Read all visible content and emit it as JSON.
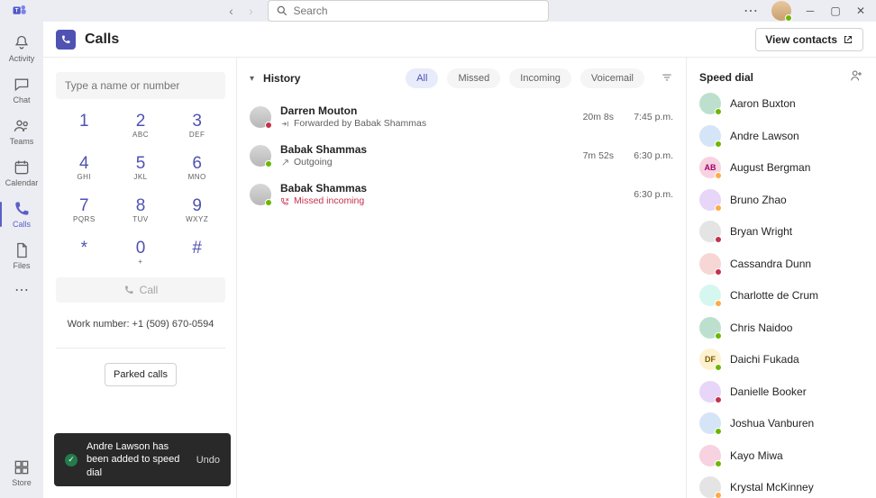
{
  "titlebar": {
    "search_placeholder": "Search"
  },
  "rail": {
    "activity": "Activity",
    "chat": "Chat",
    "teams": "Teams",
    "calendar": "Calendar",
    "calls": "Calls",
    "files": "Files",
    "store": "Store"
  },
  "page": {
    "title": "Calls",
    "view_contacts": "View contacts"
  },
  "dialer": {
    "placeholder": "Type a name or number",
    "keys": [
      {
        "num": "1",
        "sub": ""
      },
      {
        "num": "2",
        "sub": "ABC"
      },
      {
        "num": "3",
        "sub": "DEF"
      },
      {
        "num": "4",
        "sub": "GHI"
      },
      {
        "num": "5",
        "sub": "JKL"
      },
      {
        "num": "6",
        "sub": "MNO"
      },
      {
        "num": "7",
        "sub": "PQRS"
      },
      {
        "num": "8",
        "sub": "TUV"
      },
      {
        "num": "9",
        "sub": "WXYZ"
      },
      {
        "num": "*",
        "sub": ""
      },
      {
        "num": "0",
        "sub": "+"
      },
      {
        "num": "#",
        "sub": ""
      }
    ],
    "call_label": "Call",
    "work_number_label": "Work number: +1 (509) 670-0594",
    "parked_label": "Parked calls"
  },
  "history": {
    "header": "History",
    "filters": {
      "all": "All",
      "missed": "Missed",
      "incoming": "Incoming",
      "voicemail": "Voicemail"
    },
    "rows": [
      {
        "name": "Darren Mouton",
        "sub": "Forwarded by Babak Shammas",
        "kind": "fwd",
        "dur": "20m 8s",
        "time": "7:45 p.m.",
        "presence": "busy"
      },
      {
        "name": "Babak Shammas",
        "sub": "Outgoing",
        "kind": "out",
        "dur": "7m 52s",
        "time": "6:30 p.m.",
        "presence": "online"
      },
      {
        "name": "Babak Shammas",
        "sub": "Missed incoming",
        "kind": "miss",
        "dur": "",
        "time": "6:30 p.m.",
        "presence": "online"
      }
    ]
  },
  "speed": {
    "header": "Speed dial",
    "contacts": [
      {
        "name": "Aaron Buxton",
        "pres": "online",
        "cls": "c1",
        "init": ""
      },
      {
        "name": "Andre Lawson",
        "pres": "online",
        "cls": "c4",
        "init": ""
      },
      {
        "name": "August Bergman",
        "pres": "away",
        "cls": "c2",
        "init": "AB"
      },
      {
        "name": "Bruno Zhao",
        "pres": "away",
        "cls": "c5",
        "init": ""
      },
      {
        "name": "Bryan Wright",
        "pres": "busy",
        "cls": "c8",
        "init": ""
      },
      {
        "name": "Cassandra Dunn",
        "pres": "busy",
        "cls": "c6",
        "init": ""
      },
      {
        "name": "Charlotte de Crum",
        "pres": "away",
        "cls": "c7",
        "init": ""
      },
      {
        "name": "Chris Naidoo",
        "pres": "online",
        "cls": "c1",
        "init": ""
      },
      {
        "name": "Daichi Fukada",
        "pres": "online",
        "cls": "c3",
        "init": "DF"
      },
      {
        "name": "Danielle Booker",
        "pres": "busy",
        "cls": "c5",
        "init": ""
      },
      {
        "name": "Joshua Vanburen",
        "pres": "online",
        "cls": "c4",
        "init": ""
      },
      {
        "name": "Kayo Miwa",
        "pres": "online",
        "cls": "c2",
        "init": ""
      },
      {
        "name": "Krystal McKinney",
        "pres": "away",
        "cls": "c8",
        "init": ""
      }
    ]
  },
  "toast": {
    "message": "Andre Lawson has been added to speed dial",
    "undo": "Undo"
  }
}
